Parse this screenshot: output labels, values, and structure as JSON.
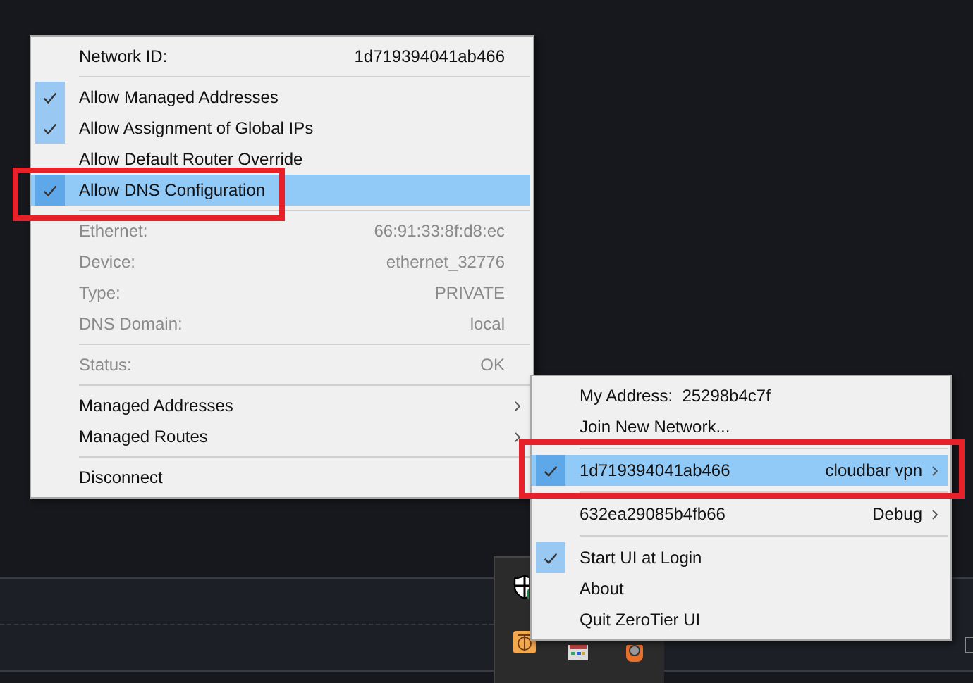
{
  "network_menu": {
    "items": [
      {
        "kind": "field",
        "label": "Network ID:",
        "value": "1d719394041ab466",
        "disabled": false
      },
      {
        "kind": "separator"
      },
      {
        "kind": "check",
        "label": "Allow Managed Addresses",
        "checked": true,
        "selected": false
      },
      {
        "kind": "check",
        "label": "Allow Assignment of Global IPs",
        "checked": true,
        "selected": false
      },
      {
        "kind": "check",
        "label": "Allow Default Router Override",
        "checked": false,
        "selected": false
      },
      {
        "kind": "check",
        "label": "Allow DNS Configuration",
        "checked": true,
        "selected": true
      },
      {
        "kind": "separator"
      },
      {
        "kind": "field",
        "label": "Ethernet:",
        "value": "66:91:33:8f:d8:ec",
        "disabled": true
      },
      {
        "kind": "field",
        "label": "Device:",
        "value": "ethernet_32776",
        "disabled": true
      },
      {
        "kind": "field",
        "label": "Type:",
        "value": "PRIVATE",
        "disabled": true
      },
      {
        "kind": "field",
        "label": "DNS Domain:",
        "value": "local",
        "disabled": true
      },
      {
        "kind": "separator"
      },
      {
        "kind": "field",
        "label": "Status:",
        "value": "OK",
        "disabled": true
      },
      {
        "kind": "separator"
      },
      {
        "kind": "submenu",
        "label": "Managed Addresses",
        "checked": false,
        "selected": false
      },
      {
        "kind": "submenu",
        "label": "Managed Routes",
        "checked": false,
        "selected": false
      },
      {
        "kind": "separator"
      },
      {
        "kind": "action",
        "label": "Disconnect",
        "selected": false
      }
    ]
  },
  "tray_menu": {
    "items": [
      {
        "kind": "action",
        "label": "My Address:  25298b4c7f",
        "selected": false
      },
      {
        "kind": "action",
        "label": "Join New Network...",
        "selected": false
      },
      {
        "kind": "separator"
      },
      {
        "kind": "submenu",
        "label": "1d719394041ab466",
        "value": "cloudbar vpn",
        "checked": true,
        "selected": true
      },
      {
        "kind": "separator"
      },
      {
        "kind": "submenu",
        "label": "632ea29085b4fb66",
        "value": "Debug",
        "checked": false,
        "selected": false
      },
      {
        "kind": "separator"
      },
      {
        "kind": "check",
        "label": "Start UI at Login",
        "checked": true,
        "selected": false
      },
      {
        "kind": "action",
        "label": "About",
        "selected": false
      },
      {
        "kind": "action",
        "label": "Quit ZeroTier UI",
        "selected": false
      }
    ]
  }
}
